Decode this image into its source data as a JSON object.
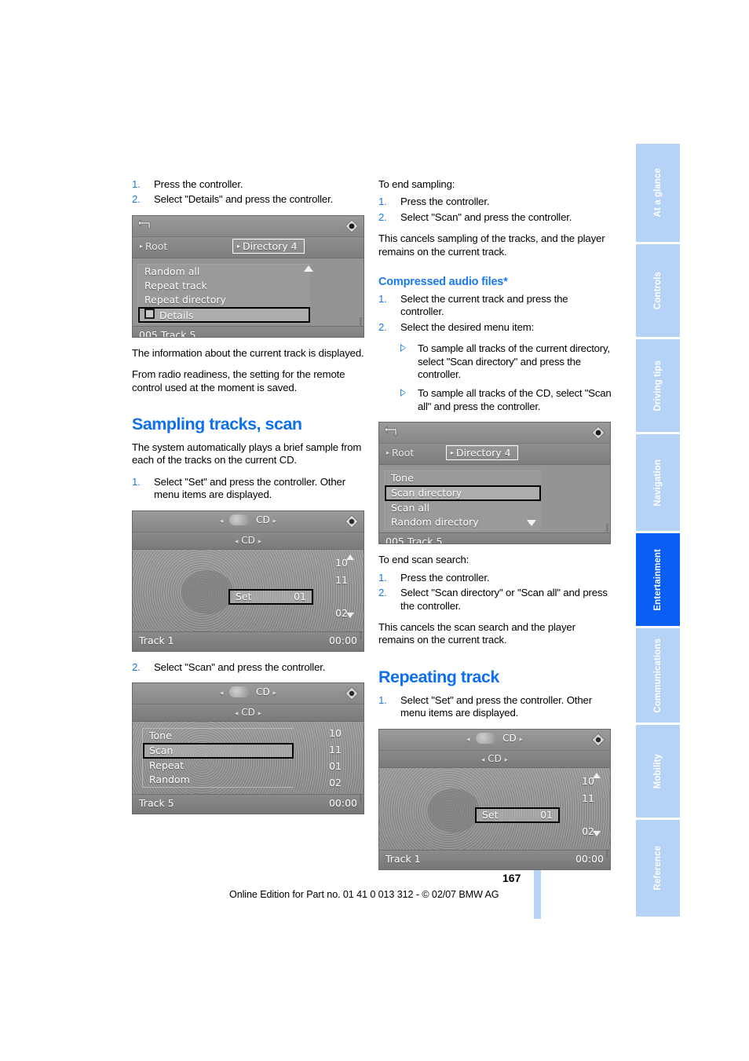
{
  "page": {
    "number": "167",
    "footer_line": "Online Edition for Part no. 01 41 0 013 312 - © 02/07 BMW AG"
  },
  "sidebar": {
    "tabs": [
      {
        "label": "At a glance",
        "active": false
      },
      {
        "label": "Controls",
        "active": false
      },
      {
        "label": "Driving tips",
        "active": false
      },
      {
        "label": "Navigation",
        "active": false
      },
      {
        "label": "Entertainment",
        "active": true
      },
      {
        "label": "Communications",
        "active": false
      },
      {
        "label": "Mobility",
        "active": false
      },
      {
        "label": "Reference",
        "active": false
      }
    ],
    "colors": {
      "inactive": "#b6d3f7",
      "active": "#0b5ef5",
      "text": "#ffffff"
    }
  },
  "left_column": {
    "steps_top": [
      {
        "num": "1.",
        "text": "Press the controller."
      },
      {
        "num": "2.",
        "text": "Select \"Details\" and press the controller."
      }
    ],
    "shot_details": {
      "back_icon": "back-arrow-icon",
      "joystick_icon": "controller-diamond-icon",
      "breadcrumb_root": "Root",
      "breadcrumb_selected": "Directory 4",
      "items": [
        {
          "label": "Random all",
          "highlighted": false,
          "checkbox": false
        },
        {
          "label": "Repeat track",
          "highlighted": false,
          "checkbox": false
        },
        {
          "label": "Repeat directory",
          "highlighted": false,
          "checkbox": false
        },
        {
          "label": "Details",
          "highlighted": true,
          "checkbox": true
        }
      ],
      "status": "005 Track 5"
    },
    "para_1": "The information about the current track is displayed.",
    "para_2": "From radio readiness, the setting for the remote control used at the moment is saved.",
    "heading_sampling": "Sampling tracks, scan",
    "para_3": "The system automatically plays a brief sample from each of the tracks on the current CD.",
    "step_set": {
      "num": "1.",
      "text": "Select \"Set\" and press the controller. Other menu items are displayed."
    },
    "shot_cd_set": {
      "header_label": "CD",
      "sub_label": "CD",
      "joystick_icon": "controller-diamond-icon",
      "track_numbers": [
        "10",
        "11",
        "02"
      ],
      "set_label": "Set",
      "set_value": "01",
      "footer_left": "Track 1",
      "footer_right": "00:00"
    },
    "step_scan": {
      "num": "2.",
      "text": "Select \"Scan\" and press the controller."
    },
    "shot_cd_menu": {
      "header_label": "CD",
      "sub_label": "CD",
      "joystick_icon": "controller-diamond-icon",
      "menu_items": [
        {
          "label": "Tone",
          "highlighted": false
        },
        {
          "label": "Scan",
          "highlighted": true
        },
        {
          "label": "Repeat",
          "highlighted": false
        },
        {
          "label": "Random",
          "highlighted": false
        }
      ],
      "track_numbers": [
        "10",
        "11",
        "01",
        "02"
      ],
      "footer_left": "Track 5",
      "footer_right": "00:00"
    }
  },
  "right_column": {
    "lead_end_sampling": "To end sampling:",
    "steps_end_sampling": [
      {
        "num": "1.",
        "text": "Press the controller."
      },
      {
        "num": "2.",
        "text": "Select \"Scan\" and press the controller."
      }
    ],
    "para_cancel_sampling": "This cancels sampling of the tracks, and the player remains on the current track.",
    "heading_compressed": "Compressed audio files*",
    "steps_compressed": [
      {
        "num": "1.",
        "text": "Select the current track and press the controller."
      },
      {
        "num": "2.",
        "text": "Select the desired menu item:"
      }
    ],
    "bullets_compressed": [
      "To sample all tracks of the current directory, select \"Scan directory\" and press the controller.",
      "To sample all tracks of the CD, select \"Scan all\" and press the controller."
    ],
    "shot_scan_dir": {
      "back_icon": "back-arrow-icon",
      "joystick_icon": "controller-diamond-icon",
      "breadcrumb_root": "Root",
      "breadcrumb_selected": "Directory 4",
      "items": [
        {
          "label": "Tone",
          "highlighted": false
        },
        {
          "label": "Scan directory",
          "highlighted": true
        },
        {
          "label": "Scan all",
          "highlighted": false
        },
        {
          "label": "Random directory",
          "highlighted": false
        }
      ],
      "status": "005 Track 5"
    },
    "lead_end_scan": "To end scan search:",
    "steps_end_scan": [
      {
        "num": "1.",
        "text": "Press the controller."
      },
      {
        "num": "2.",
        "text": "Select \"Scan directory\" or \"Scan all\" and press the controller."
      }
    ],
    "para_cancel_scan": "This cancels the scan search and the player remains on the current track.",
    "heading_repeating": "Repeating track",
    "step_repeat_set": {
      "num": "1.",
      "text": "Select \"Set\" and press the controller. Other menu items are displayed."
    },
    "shot_cd_set2": {
      "header_label": "CD",
      "sub_label": "CD",
      "joystick_icon": "controller-diamond-icon",
      "track_numbers": [
        "10",
        "11",
        "02"
      ],
      "set_label": "Set",
      "set_value": "01",
      "footer_left": "Track 1",
      "footer_right": "00:00"
    }
  },
  "colors": {
    "heading_blue": "#0f70ef",
    "step_number_blue": "#1a7aee",
    "screenshot_gray": "#8d8d8d"
  }
}
